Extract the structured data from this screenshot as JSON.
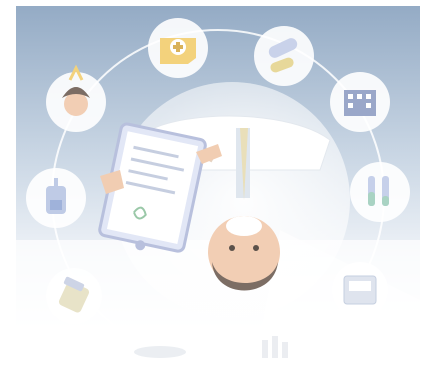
{
  "illustration": {
    "subject": "doctor-with-clipboard",
    "icons": [
      "first-aid-kit-icon",
      "pills-capsule-icon",
      "hospital-building-icon",
      "test-tubes-icon",
      "medical-device-icon",
      "pill-bottle-icon",
      "iv-bag-icon",
      "patient-avatar-icon"
    ],
    "colors": {
      "sky_top": "#97aec7",
      "sky_bottom": "#f4f6f9",
      "ring": "#ffffff",
      "accent_yellow": "#f3d27c",
      "skin": "#f0c9ab",
      "beard": "#7a6a60"
    }
  }
}
